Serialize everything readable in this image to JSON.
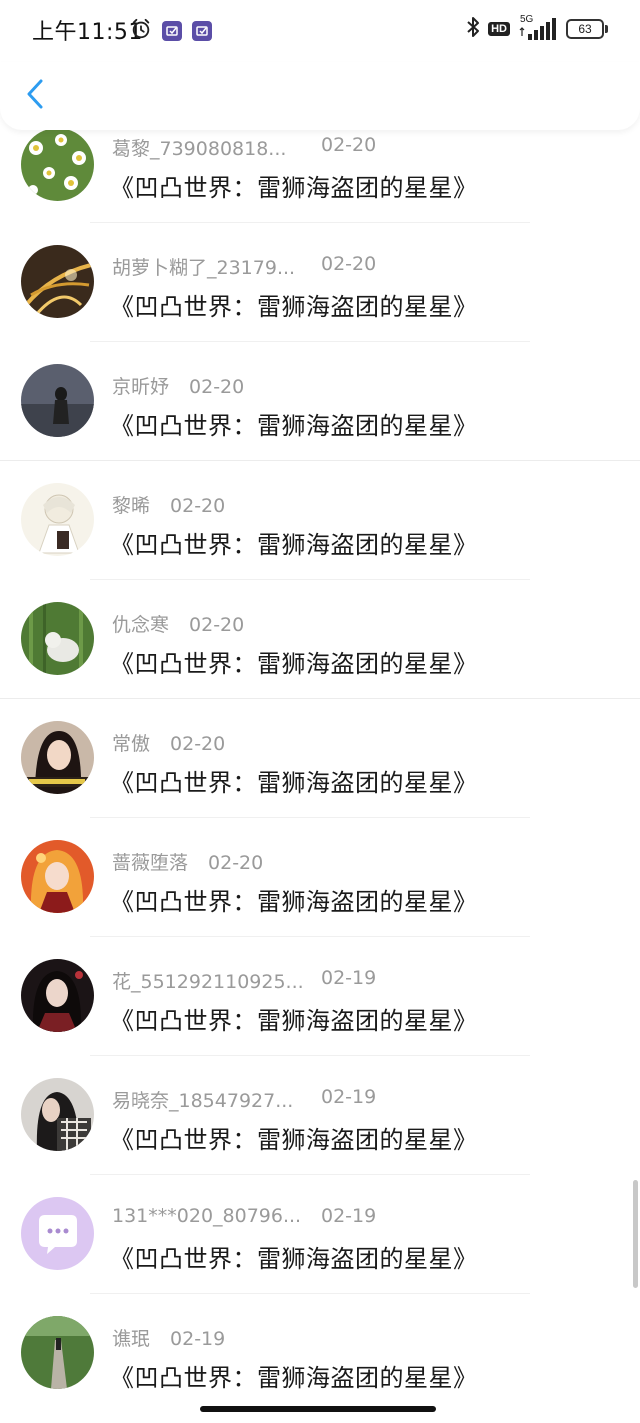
{
  "status_bar": {
    "time": "上午11:51",
    "network": "5G",
    "battery": "63",
    "hd": "HD"
  },
  "header": {
    "back_icon": "chevron-left-icon"
  },
  "colors": {
    "accent": "#2d9cf0",
    "name_text": "#9a9a9a",
    "message_text": "#1a1a1a"
  },
  "items": [
    {
      "name": "葛黎_739080818...",
      "date": "02-20",
      "message": "《凹凸世界：雷狮海盗团的星星》"
    },
    {
      "name": "胡萝卜糊了_23179...",
      "date": "02-20",
      "message": "《凹凸世界：雷狮海盗团的星星》"
    },
    {
      "name": "京昕妤",
      "date": "02-20",
      "message": "《凹凸世界：雷狮海盗团的星星》"
    },
    {
      "name": "黎晞",
      "date": "02-20",
      "message": "《凹凸世界：雷狮海盗团的星星》"
    },
    {
      "name": "仇念寒",
      "date": "02-20",
      "message": "《凹凸世界：雷狮海盗团的星星》"
    },
    {
      "name": "常傲",
      "date": "02-20",
      "message": "《凹凸世界：雷狮海盗团的星星》"
    },
    {
      "name": "蔷薇堕落",
      "date": "02-20",
      "message": "《凹凸世界：雷狮海盗团的星星》"
    },
    {
      "name": "花_551292110925...",
      "date": "02-19",
      "message": "《凹凸世界：雷狮海盗团的星星》"
    },
    {
      "name": "易晓奈_18547927...",
      "date": "02-19",
      "message": "《凹凸世界：雷狮海盗团的星星》"
    },
    {
      "name": "131***020_80796...",
      "date": "02-19",
      "message": "《凹凸世界：雷狮海盗团的星星》"
    },
    {
      "name": "谯珉",
      "date": "02-19",
      "message": "《凹凸世界：雷狮海盗团的星星》"
    }
  ]
}
